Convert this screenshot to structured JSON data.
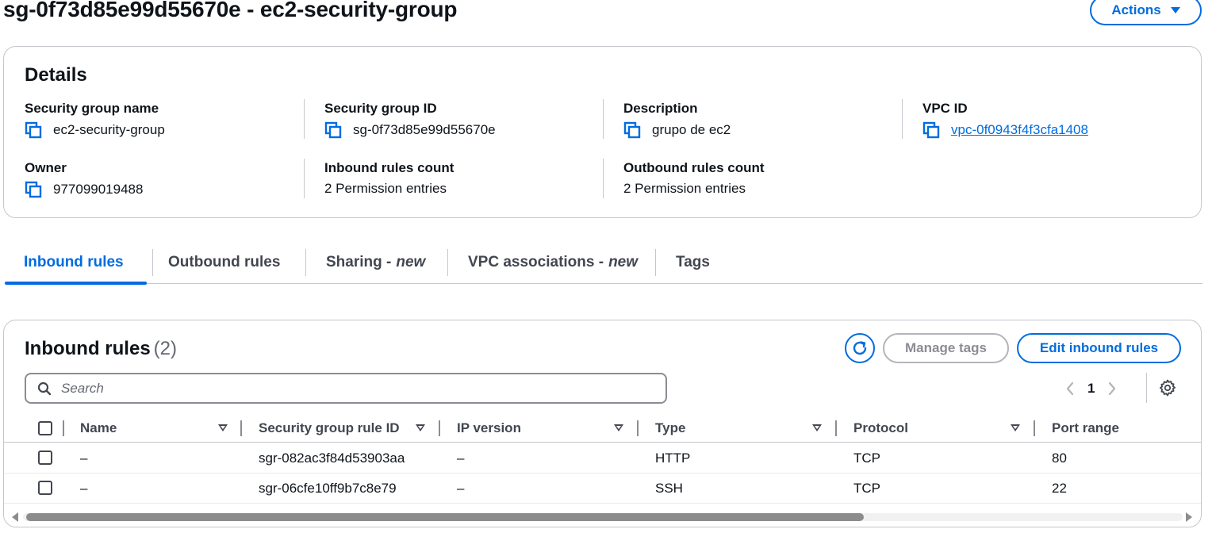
{
  "page": {
    "title": "sg-0f73d85e99d55670e - ec2-security-group",
    "actions_label": "Actions"
  },
  "details": {
    "title": "Details",
    "security_group_name": {
      "label": "Security group name",
      "value": "ec2-security-group"
    },
    "security_group_id": {
      "label": "Security group ID",
      "value": "sg-0f73d85e99d55670e"
    },
    "description": {
      "label": "Description",
      "value": "grupo de ec2"
    },
    "vpc_id": {
      "label": "VPC ID",
      "value": "vpc-0f0943f4f3cfa1408"
    },
    "owner": {
      "label": "Owner",
      "value": "977099019488"
    },
    "inbound_rules_count": {
      "label": "Inbound rules count",
      "value": "2 Permission entries"
    },
    "outbound_rules_count": {
      "label": "Outbound rules count",
      "value": "2 Permission entries"
    }
  },
  "tabs": [
    {
      "label": "Inbound rules",
      "suffix": "",
      "active": true
    },
    {
      "label": "Outbound rules",
      "suffix": "",
      "active": false
    },
    {
      "label": "Sharing -",
      "suffix": "new",
      "active": false
    },
    {
      "label": "VPC associations -",
      "suffix": "new",
      "active": false
    },
    {
      "label": "Tags",
      "suffix": "",
      "active": false
    }
  ],
  "inbound": {
    "title": "Inbound rules",
    "count": "(2)",
    "manage_tags_label": "Manage tags",
    "edit_label": "Edit inbound rules",
    "search_placeholder": "Search",
    "page_number": "1",
    "columns": [
      "Name",
      "Security group rule ID",
      "IP version",
      "Type",
      "Protocol",
      "Port range"
    ],
    "rows": [
      {
        "name": "–",
        "rule_id": "sgr-082ac3f84d53903aa",
        "ip_version": "–",
        "type": "HTTP",
        "protocol": "TCP",
        "port_range": "80"
      },
      {
        "name": "–",
        "rule_id": "sgr-06cfe10ff9b7c8e79",
        "ip_version": "–",
        "type": "SSH",
        "protocol": "TCP",
        "port_range": "22"
      }
    ]
  },
  "colors": {
    "accent": "#006ce0",
    "border": "#c6c6cd",
    "text": "#0f141a",
    "muted": "#656871"
  },
  "icons": {
    "copy": "copy-icon",
    "refresh": "refresh-icon",
    "search": "search-icon",
    "settings": "gear-icon",
    "sort": "sort-down-icon"
  }
}
